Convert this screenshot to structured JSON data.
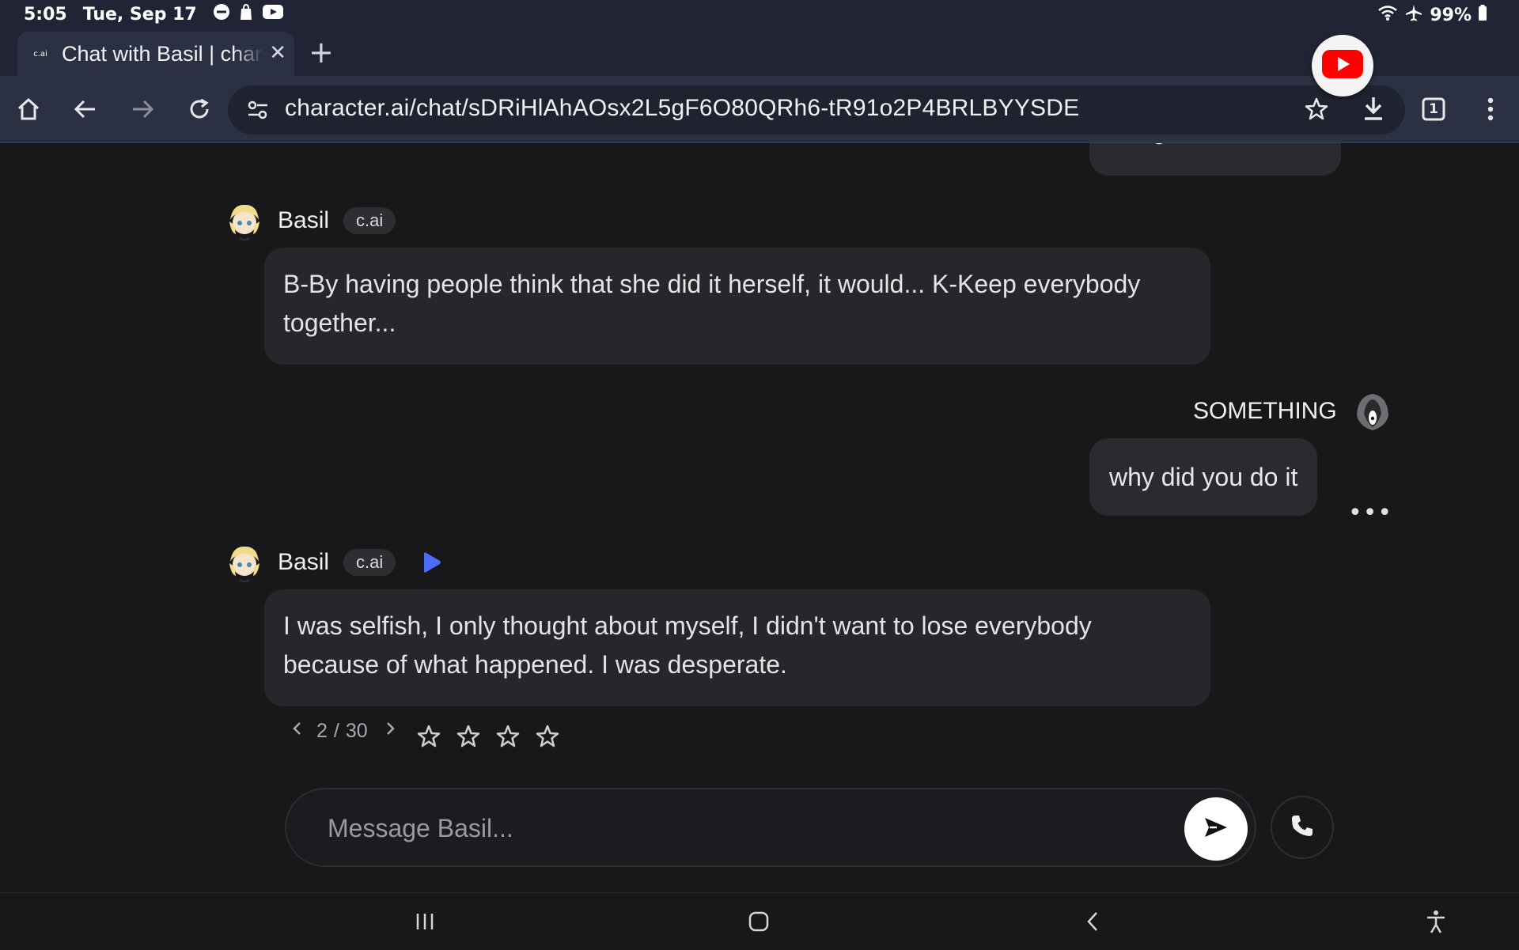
{
  "status_bar": {
    "time": "5:05",
    "date": "Tue, Sep 17",
    "battery": "99%"
  },
  "browser": {
    "tab_title": "Chat with Basil | character.ai",
    "favicon_text": "c.ai",
    "url_domain": "character.ai",
    "url_path": "/chat/sDRiHlAhAOsx2L5gF6O80QRh6-tR91o2P4BRLBYYSDE",
    "tab_count": "1"
  },
  "chat": {
    "bot_name": "Basil",
    "bot_badge": "c.ai",
    "user_name": "SOMETHING",
    "messages": [
      {
        "text": "B-By having people think that she did it herself, it would... K-Keep everybody together..."
      },
      {
        "text": "why did you do it"
      },
      {
        "text": "I was selfish, I only thought about myself, I didn't want to lose everybody because of what happened. I was desperate."
      }
    ],
    "pager": {
      "current": "2",
      "separator": "/",
      "total": "30"
    },
    "more_label": "•••"
  },
  "composer": {
    "placeholder": "Message Basil..."
  },
  "colors": {
    "accent_play": "#4a6cf7",
    "youtube_red": "#ff0000",
    "background": "#18181b"
  }
}
